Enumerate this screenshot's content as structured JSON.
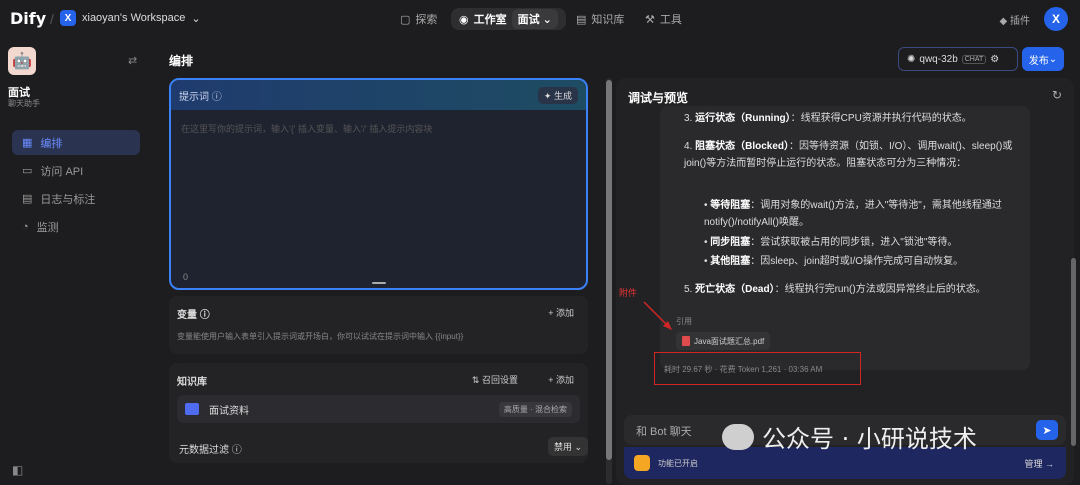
{
  "topbar": {
    "logo": "Dify",
    "workspace_badge": "X",
    "workspace_name": "xiaoyan's Workspace",
    "nav": [
      "探索",
      "工作室",
      "面试",
      "知识库",
      "工具"
    ],
    "plugins": "插件",
    "avatar": "X"
  },
  "sidebar": {
    "app_icon": "🤖",
    "app_name": "面试",
    "app_type": "聊天助手",
    "items": [
      {
        "label": "编排",
        "icon": "layout-icon"
      },
      {
        "label": "访问 API",
        "icon": "terminal-icon"
      },
      {
        "label": "日志与标注",
        "icon": "log-icon"
      },
      {
        "label": "监测",
        "icon": "monitor-icon"
      }
    ]
  },
  "editor": {
    "title": "编排",
    "prompt_label": "提示词",
    "generate": "生成",
    "prompt_placeholder": "在这里写你的提示词，输入'{' 插入变量、输入'/' 插入提示内容块",
    "prompt_count": "0",
    "variables_title": "变量",
    "add": "添加",
    "variables_desc": "变量能使用户输入表单引入提示词或开场白，你可以试试在提示词中输入 {{input}}",
    "kb_title": "知识库",
    "recall_settings": "召回设置",
    "kb_item": "面试资料",
    "kb_badge": "高质量 · 混合检索",
    "meta_filter": "元数据过滤",
    "meta_filter_btn": "禁用"
  },
  "header_right": {
    "model": "qwq-32b",
    "model_tag": "CHAT",
    "publish": "发布"
  },
  "preview": {
    "title": "调试与预览",
    "list": [
      {
        "num": "3.",
        "bold": "运行状态（Running）",
        "text": "：线程获得CPU资源并执行代码的状态。"
      },
      {
        "num": "4.",
        "bold": "阻塞状态（Blocked）",
        "text": "：因等待资源（如锁、I/O）、调用wait()、sleep()或join()等方法而暂时停止运行的状态。阻塞状态可分为三种情况："
      },
      {
        "num": "5.",
        "bold": "死亡状态（Dead）",
        "text": "：线程执行完run()方法或因异常终止后的状态。"
      }
    ],
    "sub": [
      {
        "bold": "等待阻塞",
        "text": "：调用对象的wait()方法，进入\"等待池\"，需其他线程通过notify()/notifyAll()唤醒。"
      },
      {
        "bold": "同步阻塞",
        "text": "：尝试获取被占用的同步锁，进入\"锁池\"等待。"
      },
      {
        "bold": "其他阻塞",
        "text": "：因sleep、join超时或I/O操作完成可自动恢复。"
      }
    ],
    "cite_label": "引用",
    "cite_file": "Java面试题汇总.pdf",
    "stats": "耗时 29.67 秒 · 花费 Token 1,261 · 03:36 AM",
    "annotation": "附件",
    "input_placeholder": "和 Bot 聊天",
    "feature_text": "功能已开启",
    "manage": "管理 →"
  },
  "watermark": "公众号 · 小研说技术",
  "colors": {
    "accent": "#2563eb",
    "annotation": "#d12626"
  }
}
